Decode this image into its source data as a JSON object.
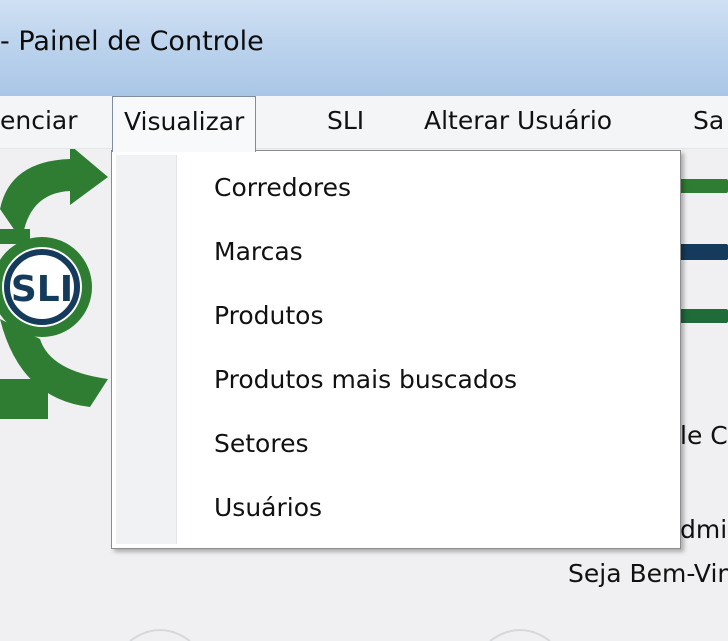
{
  "window": {
    "title": "- Painel de Controle"
  },
  "menubar": {
    "items": [
      {
        "label": "enciar"
      },
      {
        "label": "Visualizar"
      },
      {
        "label": "SLI"
      },
      {
        "label": "Alterar Usuário"
      },
      {
        "label": "Sa"
      }
    ]
  },
  "dropdown": {
    "items": [
      {
        "label": "Corredores"
      },
      {
        "label": "Marcas"
      },
      {
        "label": "Produtos"
      },
      {
        "label": "Produtos mais buscados"
      },
      {
        "label": "Setores"
      },
      {
        "label": "Usuários"
      }
    ]
  },
  "logo": {
    "text": "SLI"
  },
  "welcome": {
    "line1_fragment": "le C",
    "line2_fragment": "dmi",
    "line3": "Seja Bem-Vin"
  },
  "colors": {
    "brand_green": "#2e7d32",
    "brand_navy": "#153b5c",
    "stripe_green": "#1f6b3a"
  }
}
